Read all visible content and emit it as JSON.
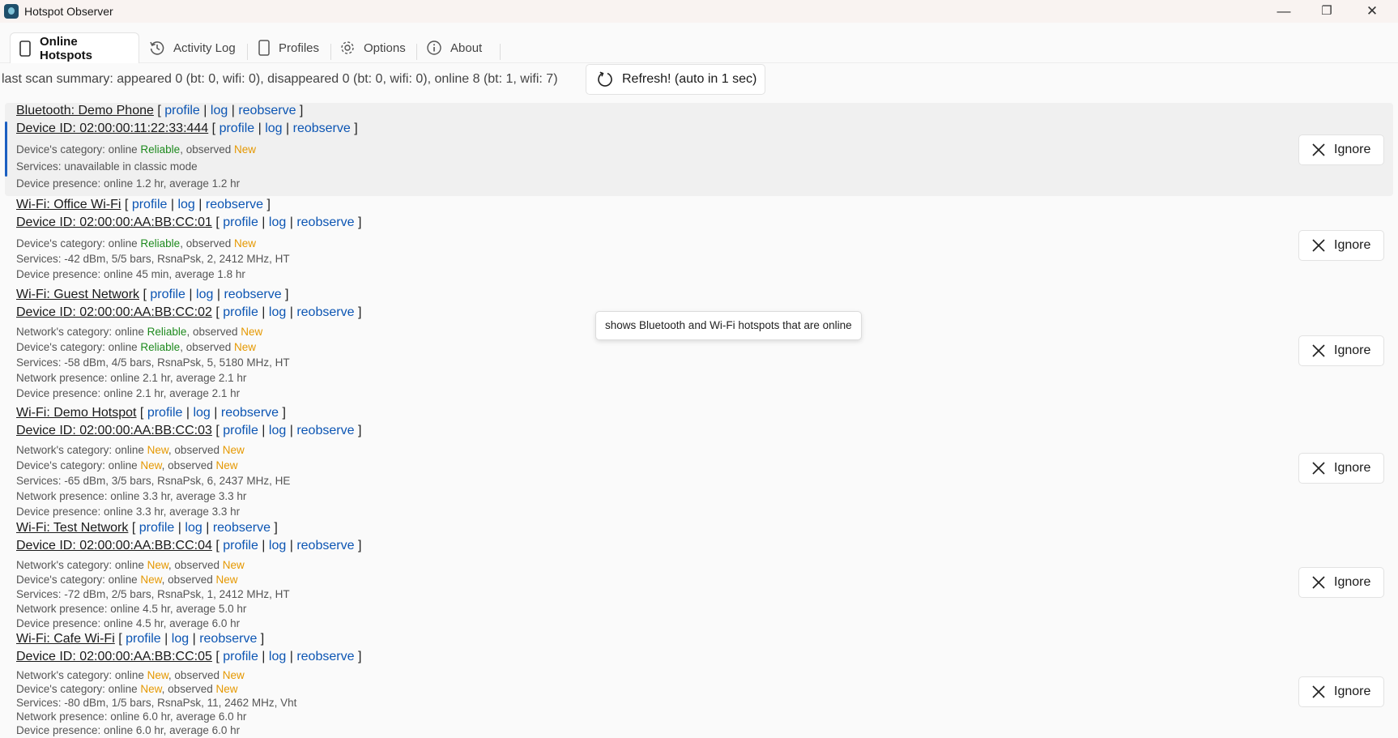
{
  "window": {
    "title": "Hotspot Observer",
    "minimize": "—",
    "maximize": "❐",
    "close": "✕"
  },
  "tabs": [
    {
      "label": "Online Hotspots",
      "icon": "device-icon"
    },
    {
      "label": "Activity Log",
      "icon": "history-icon"
    },
    {
      "label": "Profiles",
      "icon": "profile-icon"
    },
    {
      "label": "Options",
      "icon": "gear-icon"
    },
    {
      "label": "About",
      "icon": "info-icon"
    }
  ],
  "summary": "last scan summary: appeared 0 (bt: 0, wifi: 0), disappeared 0 (bt: 0, wifi: 0), online 8 (bt: 1, wifi: 7)",
  "refresh_label": "Refresh! (auto in 1 sec)",
  "tooltip": "shows Bluetooth and Wi-Fi hotspots that are online",
  "links": {
    "profile": "profile",
    "log": "log",
    "reobserve": "reobserve",
    "open": "[",
    "sep": "|",
    "close": "]"
  },
  "ignore_label": "Ignore",
  "groups": [
    {
      "network": "Bluetooth: Demo Phone",
      "device": "Device ID: 02:00:00:11:22:33:444",
      "network_category": null,
      "device_category": {
        "prefix": "Device's category: online ",
        "a": "Reliable",
        "mid": ", observed ",
        "b": "New"
      },
      "services": "Services: unavailable in classic mode",
      "network_presence": null,
      "device_presence": "Device presence: online 1.2 hr, average 1.2 hr"
    },
    {
      "network": "Wi-Fi: Office Wi-Fi",
      "device": "Device ID: 02:00:00:AA:BB:CC:01",
      "network_category": null,
      "device_category": {
        "prefix": "Device's category: online ",
        "a": "Reliable",
        "mid": ", observed ",
        "b": "New"
      },
      "services": "Services: -42 dBm, 5/5 bars, RsnaPsk, 2, 2412 MHz, HT",
      "network_presence": null,
      "device_presence": "Device presence: online 45 min, average 1.8 hr"
    },
    {
      "network": "Wi-Fi: Guest Network",
      "device": "Device ID: 02:00:00:AA:BB:CC:02",
      "network_category": {
        "prefix": "Network's category: online ",
        "a": "Reliable",
        "mid": ", observed ",
        "b": "New"
      },
      "device_category": {
        "prefix": "Device's category: online ",
        "a": "Reliable",
        "mid": ", observed ",
        "b": "New"
      },
      "services": "Services: -58 dBm, 4/5 bars, RsnaPsk, 5, 5180 MHz, HT",
      "network_presence": "Network presence: online 2.1 hr, average 2.1 hr",
      "device_presence": "Device presence: online 2.1 hr, average 2.1 hr"
    },
    {
      "network": "Wi-Fi: Demo Hotspot",
      "device": "Device ID: 02:00:00:AA:BB:CC:03",
      "network_category": {
        "prefix": "Network's category: online ",
        "a": "New",
        "mid": ", observed ",
        "b": "New"
      },
      "device_category": {
        "prefix": "Device's category: online ",
        "a": "New",
        "mid": ", observed ",
        "b": "New"
      },
      "services": "Services: -65 dBm, 3/5 bars, RsnaPsk, 6, 2437 MHz, HE",
      "network_presence": "Network presence: online 3.3 hr, average 3.3 hr",
      "device_presence": "Device presence: online 3.3 hr, average 3.3 hr"
    },
    {
      "network": "Wi-Fi: Test Network",
      "device": "Device ID: 02:00:00:AA:BB:CC:04",
      "network_category": {
        "prefix": "Network's category: online ",
        "a": "New",
        "mid": ", observed ",
        "b": "New"
      },
      "device_category": {
        "prefix": "Device's category: online ",
        "a": "New",
        "mid": ", observed ",
        "b": "New"
      },
      "services": "Services: -72 dBm, 2/5 bars, RsnaPsk, 1, 2412 MHz, HT",
      "network_presence": "Network presence: online 4.5 hr, average 5.0 hr",
      "device_presence": "Device presence: online 4.5 hr, average 6.0 hr"
    },
    {
      "network": "Wi-Fi: Cafe Wi-Fi",
      "device": "Device ID: 02:00:00:AA:BB:CC:05",
      "network_category": {
        "prefix": "Network's category: online ",
        "a": "New",
        "mid": ", observed ",
        "b": "New"
      },
      "device_category": {
        "prefix": "Device's category: online ",
        "a": "New",
        "mid": ", observed ",
        "b": "New"
      },
      "services": "Services: -80 dBm, 1/5 bars, RsnaPsk, 11, 2462 MHz, Vht",
      "network_presence": "Network presence: online 6.0 hr, average 6.0 hr",
      "device_presence": "Device presence: online 6.0 hr, average 6.0 hr"
    }
  ],
  "colors": {
    "link": "#0c55b3",
    "reliable": "#1e8a1e",
    "new": "#e59800",
    "selection_accent": "#1b5fc1"
  }
}
